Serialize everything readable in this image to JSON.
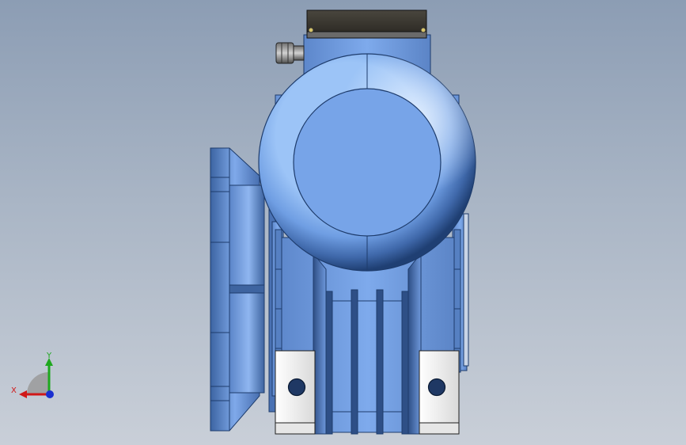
{
  "viewport": {
    "background_top": "#8c9db4",
    "background_bottom": "#c9cfd8"
  },
  "model": {
    "body_color": "#7aa6e8",
    "dark_color": "#1e3c6c",
    "terminal_box_color": "#3e3a32",
    "foot_color": "#f2f2f2"
  },
  "triad": {
    "x_label": "X",
    "y_label": "Y",
    "x_color": "#d01818",
    "y_color": "#1ea81e",
    "z_color": "#1a2fd0"
  }
}
